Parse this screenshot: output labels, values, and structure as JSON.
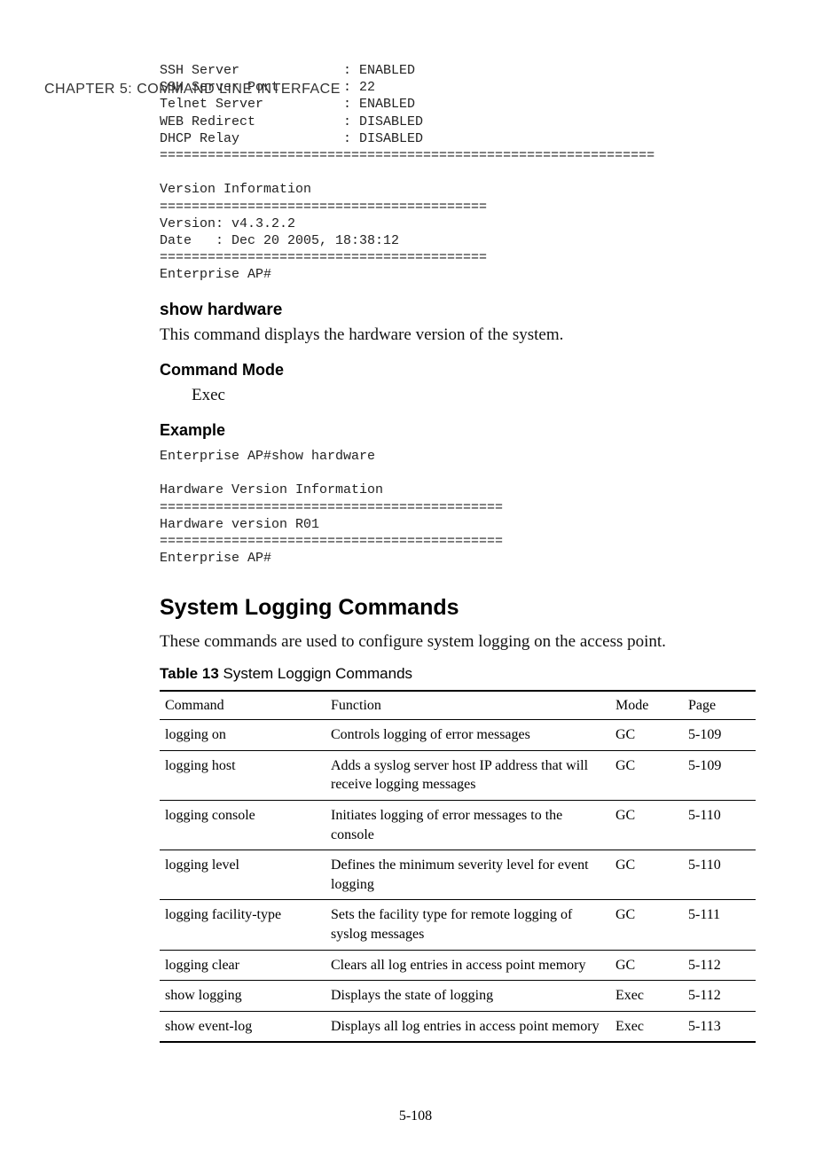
{
  "header": {
    "running": "CHAPTER 5: COMMAND LINE INTERFACE"
  },
  "code1": "SSH Server             : ENABLED\nSSH Server Port        : 22\nTelnet Server          : ENABLED\nWEB Redirect           : DISABLED\nDHCP Relay             : DISABLED\n==============================================================\n\nVersion Information\n=========================================\nVersion: v4.3.2.2\nDate   : Dec 20 2005, 18:38:12\n=========================================\nEnterprise AP#",
  "sh_hw": {
    "title": "show hardware",
    "desc": "This command displays the hardware version of the system.",
    "mode_label": "Command Mode",
    "mode_value": "Exec",
    "example_label": "Example"
  },
  "code2": "Enterprise AP#show hardware\n\nHardware Version Information\n===========================================\nHardware version R01\n===========================================\nEnterprise AP#",
  "section": {
    "title": "System Logging Commands",
    "intro": "These commands are used to configure system logging on the access point."
  },
  "table": {
    "caption_bold": "Table 13",
    "caption_rest": "   System Loggign Commands",
    "headers": {
      "cmd": "Command",
      "func": "Function",
      "mode": "Mode",
      "page": "Page"
    },
    "rows": [
      {
        "cmd": "logging on",
        "func": "Controls logging of error messages",
        "mode": "GC",
        "page": "5-109"
      },
      {
        "cmd": "logging  host",
        "func": "Adds a syslog server host IP address that will receive logging messages",
        "mode": "GC",
        "page": "5-109"
      },
      {
        "cmd": "logging console",
        "func": "Initiates logging of error messages to the console",
        "mode": "GC",
        "page": "5-110"
      },
      {
        "cmd": "logging level",
        "func": "Defines the minimum severity level for event logging",
        "mode": "GC",
        "page": "5-110"
      },
      {
        "cmd": "logging facility-type",
        "func": "Sets the facility type for remote logging of syslog messages",
        "mode": "GC",
        "page": "5-111"
      },
      {
        "cmd": "logging clear",
        "func": "Clears all log entries in access point memory",
        "mode": "GC",
        "page": "5-112"
      },
      {
        "cmd": "show logging",
        "func": "Displays the state of logging",
        "mode": "Exec",
        "page": "5-112"
      },
      {
        "cmd": "show event-log",
        "func": "Displays all log entries in access point memory",
        "mode": "Exec",
        "page": "5-113"
      }
    ]
  },
  "page_number": "5-108"
}
